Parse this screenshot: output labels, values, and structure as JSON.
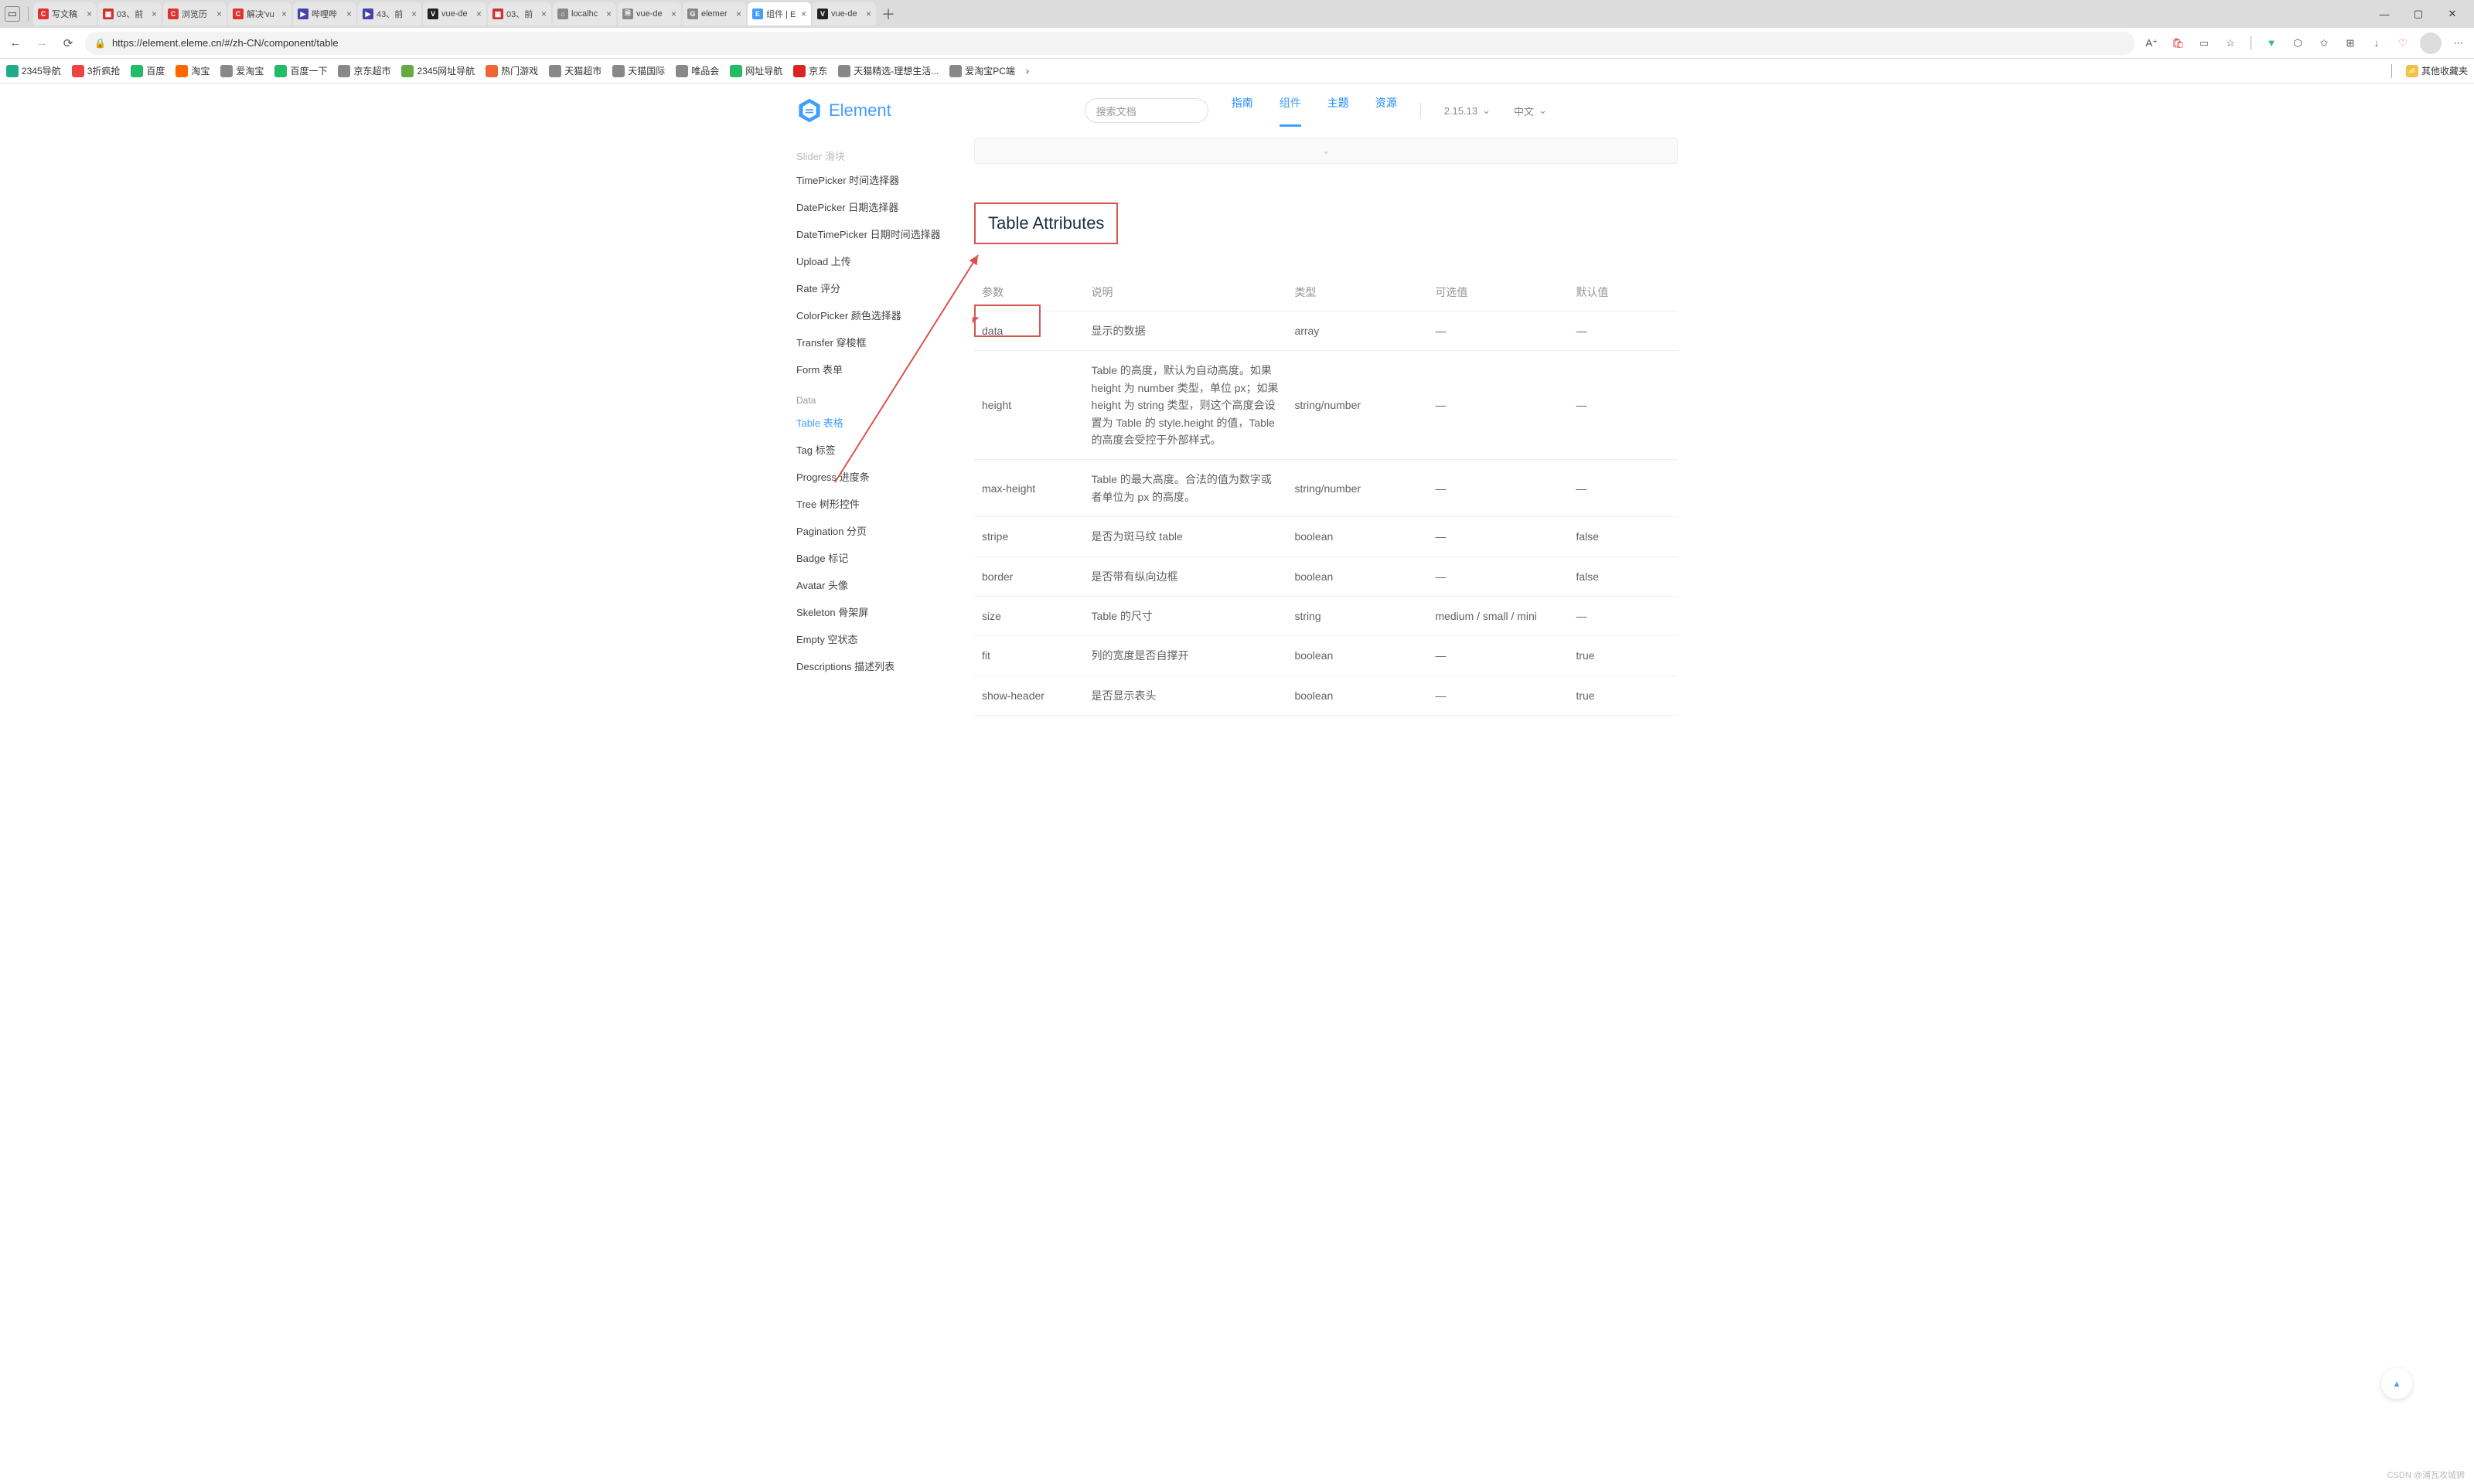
{
  "browser": {
    "url": "https://element.eleme.cn/#/zh-CN/component/table",
    "tabs": [
      {
        "label": "写文稿",
        "favColor": "#d33",
        "favTxt": "C"
      },
      {
        "label": "03、前",
        "favColor": "#c33",
        "favTxt": "▦"
      },
      {
        "label": "浏览历",
        "favColor": "#d33",
        "favTxt": "C"
      },
      {
        "label": "解决'vu",
        "favColor": "#d33",
        "favTxt": "C"
      },
      {
        "label": "哔哩哔",
        "favColor": "#44a",
        "favTxt": "▶"
      },
      {
        "label": "43、前",
        "favColor": "#44a",
        "favTxt": "▶"
      },
      {
        "label": "vue-de",
        "favColor": "#222",
        "favTxt": "V"
      },
      {
        "label": "03、前",
        "favColor": "#c33",
        "favTxt": "▦"
      },
      {
        "label": "localhc",
        "favColor": "#888",
        "favTxt": "⌂"
      },
      {
        "label": "vue-de",
        "favColor": "#888",
        "favTxt": "🗎"
      },
      {
        "label": "elemer",
        "favColor": "#888",
        "favTxt": "G"
      },
      {
        "label": "组件 | E",
        "favColor": "#409eff",
        "favTxt": "E",
        "active": true
      },
      {
        "label": "vue-de",
        "favColor": "#222",
        "favTxt": "V"
      }
    ],
    "bookmarks": [
      {
        "label": "2345导航",
        "color": "#2a8"
      },
      {
        "label": "3折疯抢",
        "color": "#e44"
      },
      {
        "label": "百度",
        "color": "#2b6"
      },
      {
        "label": "淘宝",
        "color": "#f60"
      },
      {
        "label": "爱淘宝",
        "color": "#888"
      },
      {
        "label": "百度一下",
        "color": "#2b6"
      },
      {
        "label": "京东超市",
        "color": "#888"
      },
      {
        "label": "2345网址导航",
        "color": "#6a4"
      },
      {
        "label": "热门游戏",
        "color": "#e63"
      },
      {
        "label": "天猫超市",
        "color": "#888"
      },
      {
        "label": "天猫国际",
        "color": "#888"
      },
      {
        "label": "唯品会",
        "color": "#888"
      },
      {
        "label": "网址导航",
        "color": "#2b6"
      },
      {
        "label": "京东",
        "color": "#d22"
      },
      {
        "label": "天猫精选-理想生活...",
        "color": "#888"
      },
      {
        "label": "爱淘宝PC端",
        "color": "#888"
      }
    ],
    "other_bookmarks": "其他收藏夹"
  },
  "topnav": {
    "logo": "Element",
    "search_placeholder": "搜索文档",
    "links": [
      "指南",
      "组件",
      "主题",
      "资源"
    ],
    "active_link": "组件",
    "version": "2.15.13",
    "lang": "中文"
  },
  "sidebar": {
    "items": [
      {
        "label": "Slider 滑块",
        "class": "cut"
      },
      {
        "label": "TimePicker 时间选择器"
      },
      {
        "label": "DatePicker 日期选择器"
      },
      {
        "label": "DateTimePicker 日期时间选择器"
      },
      {
        "label": "Upload 上传"
      },
      {
        "label": "Rate 评分"
      },
      {
        "label": "ColorPicker 颜色选择器"
      },
      {
        "label": "Transfer 穿梭框"
      },
      {
        "label": "Form 表单"
      }
    ],
    "group": "Data",
    "data_items": [
      {
        "label": "Table 表格",
        "active": true
      },
      {
        "label": "Tag 标签"
      },
      {
        "label": "Progress 进度条"
      },
      {
        "label": "Tree 树形控件"
      },
      {
        "label": "Pagination 分页"
      },
      {
        "label": "Badge 标记"
      },
      {
        "label": "Avatar 头像"
      },
      {
        "label": "Skeleton 骨架屏"
      },
      {
        "label": "Empty 空状态"
      },
      {
        "label": "Descriptions 描述列表"
      }
    ]
  },
  "main": {
    "section_title": "Table Attributes",
    "columns": [
      "参数",
      "说明",
      "类型",
      "可选值",
      "默认值"
    ],
    "rows": [
      {
        "param": "data",
        "desc": "显示的数据",
        "type": "array",
        "opts": "—",
        "def": "—"
      },
      {
        "param": "height",
        "desc": "Table 的高度，默认为自动高度。如果 height 为 number 类型，单位 px；如果 height 为 string 类型，则这个高度会设置为 Table 的 style.height 的值，Table 的高度会受控于外部样式。",
        "type": "string/number",
        "opts": "—",
        "def": "—"
      },
      {
        "param": "max-height",
        "desc": "Table 的最大高度。合法的值为数字或者单位为 px 的高度。",
        "type": "string/number",
        "opts": "—",
        "def": "—"
      },
      {
        "param": "stripe",
        "desc": "是否为斑马纹 table",
        "type": "boolean",
        "opts": "—",
        "def": "false"
      },
      {
        "param": "border",
        "desc": "是否带有纵向边框",
        "type": "boolean",
        "opts": "—",
        "def": "false"
      },
      {
        "param": "size",
        "desc": "Table 的尺寸",
        "type": "string",
        "opts": "medium / small / mini",
        "def": "—"
      },
      {
        "param": "fit",
        "desc": "列的宽度是否自撑开",
        "type": "boolean",
        "opts": "—",
        "def": "true"
      },
      {
        "param": "show-header",
        "desc": "是否显示表头",
        "type": "boolean",
        "opts": "—",
        "def": "true"
      }
    ]
  },
  "watermark": "CSDN @浦瓦攻城狮"
}
